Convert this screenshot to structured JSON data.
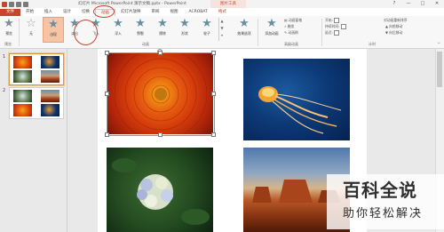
{
  "window": {
    "title": "幻灯片 Microsoft PowerPoint 演示文稿.pptx - PowerPoint",
    "context_tools": "图片工具",
    "controls": [
      "?",
      "—",
      "□",
      "✕"
    ]
  },
  "tabs": [
    {
      "label": "文件",
      "kind": "file"
    },
    {
      "label": "开始"
    },
    {
      "label": "插入"
    },
    {
      "label": "设计"
    },
    {
      "label": "切换"
    },
    {
      "label": "动画",
      "kind": "active"
    },
    {
      "label": "幻灯片放映"
    },
    {
      "label": "审阅"
    },
    {
      "label": "视图"
    },
    {
      "label": "ACROBAT"
    },
    {
      "label": "格式",
      "kind": "fmt"
    }
  ],
  "ribbon": {
    "preview_label": "预览",
    "effects": [
      "无",
      "出现",
      "淡出",
      "飞入",
      "浮入",
      "劈裂",
      "擦除",
      "形状",
      "轮子"
    ],
    "effect_options": "效果选项",
    "add_animation": "添加动画",
    "animation_pane": "动画窗格",
    "trigger": "触发",
    "animation_painter": "动画刷",
    "start_label": "开始:",
    "duration_label": "持续时间:",
    "delay_label": "延迟:",
    "reorder_title": "对动画重新排序",
    "move_earlier": "向前移动",
    "move_later": "向后移动",
    "group_preview": "预览",
    "group_animation": "动画",
    "group_advanced": "高级动画",
    "group_timing": "计时",
    "collapse": "^"
  },
  "slides": [
    {
      "number": "1"
    },
    {
      "number": "2"
    }
  ],
  "watermark": {
    "title": "百科全说",
    "subtitle": "助你轻松解决"
  },
  "colors": {
    "accent": "#c8442c",
    "selected_effect": "#f6c3a4"
  }
}
